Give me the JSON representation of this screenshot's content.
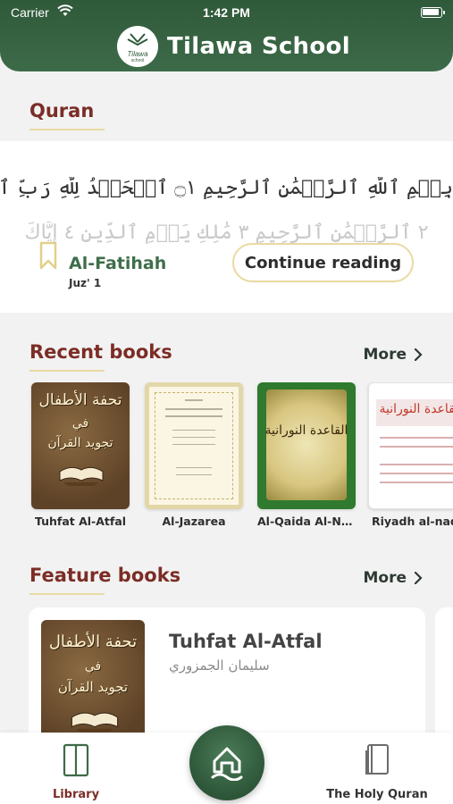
{
  "status_bar": {
    "carrier": "Carrier",
    "time": "1:42 PM"
  },
  "header": {
    "title": "Tilawa School",
    "logo_text": "Tilawa",
    "logo_subtext": "school"
  },
  "quran": {
    "section_title": "Quran",
    "ayah_line_1": "بِسۡمِ ٱللَّهِ ٱلرَّحۡمَٰنِ ٱلرَّحِيمِ ۝١ ٱلۡحَمۡدُ لِلَّهِ رَبِّ ٱلۡعَٰلَمِينَ",
    "ayah_line_2": "٢ ٱلرَّحۡمَٰنِ ٱلرَّحِيمِ ٣ مَٰلِكِ يَوۡمِ ٱلدِّينِ ٤ إِيَّاكَ",
    "surah_name": "Al-Fatihah",
    "juz": "Juz' 1",
    "continue_label": "Continue reading"
  },
  "recent_books": {
    "section_title": "Recent books",
    "more_label": "More",
    "items": [
      {
        "title": "Tuhfat Al-Atfal",
        "cover_text_1": "تحفة الأطفال",
        "cover_text_2": "في",
        "cover_text_3": "تجويد القرآن"
      },
      {
        "title": "Al-Jazarea"
      },
      {
        "title": "Al-Qaida Al-No...",
        "cover_text": "القاعدة النورانية"
      },
      {
        "title": "Riyadh al-nad",
        "cover_text": "القاعدة النورانية"
      }
    ]
  },
  "feature_books": {
    "section_title": "Feature books",
    "more_label": "More",
    "items": [
      {
        "title": "Tuhfat Al-Atfal",
        "author": "سليمان الجمزوري",
        "cover_text_1": "تحفة الأطفال",
        "cover_text_2": "في",
        "cover_text_3": "تجويد القرآن"
      }
    ]
  },
  "tabbar": {
    "library_label": "Library",
    "quran_label": "The Holy Quran"
  },
  "colors": {
    "primary_green": "#3d6a48",
    "accent_maroon": "#7b2d26",
    "accent_gold": "#ead9a0"
  },
  "icons": [
    "wifi-icon",
    "battery-icon",
    "bookmark-icon",
    "chevron-right-icon",
    "library-icon",
    "home-icon",
    "book-icon"
  ]
}
